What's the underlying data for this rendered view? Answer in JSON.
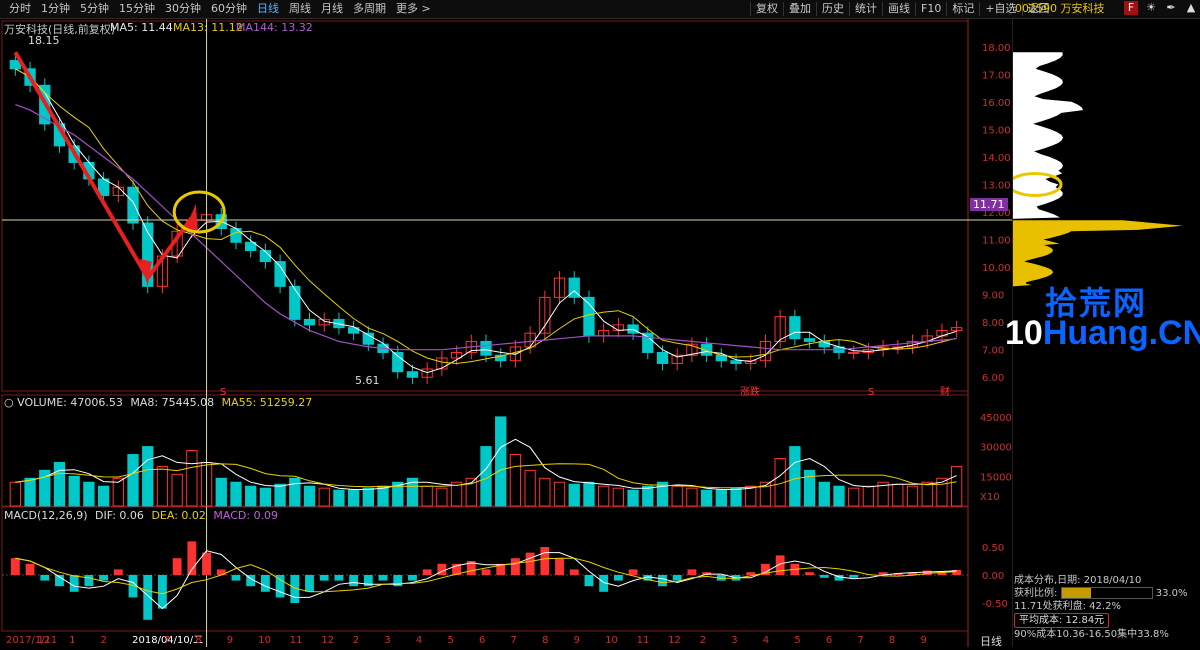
{
  "toolbar": {
    "tabs": [
      "分时",
      "1分钟",
      "5分钟",
      "15分钟",
      "30分钟",
      "60分钟",
      "日线",
      "周线",
      "月线",
      "多周期",
      "更多 >"
    ],
    "active_tab": "日线",
    "tools": [
      "复权",
      "叠加",
      "历史",
      "统计",
      "画线",
      "F10",
      "标记",
      "+自选",
      "返回"
    ],
    "stock": "002590 万安科技"
  },
  "price_panel": {
    "header": "万安科技(日线,前复权)",
    "ma5": "MA5: 11.44",
    "ma13": "MA13: 11.12",
    "ma144": "MA144: 13.32",
    "high_label": "18.15",
    "low_label": "5.61",
    "current": "11.71",
    "y_ticks": [
      "16.00",
      "17.00",
      "16.00",
      "15.00",
      "14.00",
      "13.00",
      "12.00",
      "11.00",
      "10.00",
      "9.00",
      "8.00",
      "7.00",
      "6.00"
    ],
    "markers": [
      "S",
      "涨跌",
      "S",
      "财"
    ]
  },
  "volume_panel": {
    "header_dot": "○",
    "volume": "VOLUME: 47006.53",
    "ma8": "MA8: 75445.08",
    "ma55": "MA55: 51259.27",
    "y_ticks": [
      "45000",
      "30000",
      "15000",
      "X10"
    ]
  },
  "macd_panel": {
    "header": "MACD(12,26,9)",
    "dif": "DIF: 0.06",
    "dea": "DEA: 0.02",
    "macd": "MACD: 0.09",
    "y_ticks": [
      "0.50",
      "0.00",
      "-0.50"
    ]
  },
  "x_axis": {
    "labels": [
      "2017/1/11",
      "12",
      "1",
      "2",
      "2018/04/10/二",
      "7",
      "8",
      "9",
      "10",
      "11",
      "12",
      "2",
      "3",
      "4",
      "5",
      "6",
      "7",
      "8",
      "9",
      "10",
      "11",
      "12",
      "2",
      "3",
      "4",
      "5",
      "6",
      "7",
      "8",
      "9"
    ],
    "period": "日线"
  },
  "cost_distribution": {
    "date": "成本分布,日期: 2018/04/10",
    "profit_ratio_label": "获利比例:",
    "profit_ratio": "33.0%",
    "profit_ratio_value": 0.33,
    "chips_line": "11.71处获利盘: 42.2%",
    "avg_cost": "平均成本: 12.84元",
    "concentration": "90%成本10.36-16.50集中33.8%"
  },
  "watermark": {
    "cn": "拾荒网",
    "prefix": "10",
    "rest": "Huang.CN"
  },
  "colors": {
    "up": "#ff3232",
    "down": "#00c8c8",
    "ma5": "#ffffff",
    "ma13": "#e8d000",
    "ma144": "#a050c8",
    "axis": "#c83232",
    "chip_profit": "#e8c000",
    "chip_loss": "#ffffff",
    "annotation": "#e82020"
  },
  "chart_data": {
    "type": "candlestick",
    "title": "万安科技(日线,前复权)",
    "ylim": [
      5.5,
      18.5
    ],
    "close": [
      17.2,
      16.6,
      15.2,
      14.4,
      13.8,
      13.2,
      12.6,
      12.9,
      11.6,
      9.3,
      10.4,
      11.3,
      11.7,
      11.9,
      11.4,
      10.9,
      10.6,
      10.2,
      9.3,
      8.1,
      7.9,
      8.1,
      7.8,
      7.6,
      7.2,
      6.9,
      6.2,
      6.0,
      6.3,
      6.7,
      6.9,
      7.3,
      6.8,
      6.6,
      7.1,
      7.6,
      8.9,
      9.6,
      8.9,
      7.5,
      7.7,
      7.9,
      7.6,
      6.9,
      6.5,
      6.8,
      7.2,
      6.8,
      6.6,
      6.5,
      6.6,
      7.3,
      8.2,
      7.4,
      7.3,
      7.1,
      6.9,
      6.9,
      7.0,
      7.1,
      7.1,
      7.3,
      7.5,
      7.7,
      7.8
    ],
    "ma144": [
      15.9,
      15.7,
      15.4,
      15.1,
      14.8,
      14.4,
      14.0,
      13.6,
      13.2,
      12.7,
      12.2,
      11.7,
      11.2,
      10.7,
      10.2,
      9.7,
      9.2,
      8.7,
      8.3,
      8.0,
      7.7,
      7.5,
      7.3,
      7.2,
      7.1,
      7.05,
      7.0,
      7.0,
      7.0,
      7.0,
      7.05,
      7.1,
      7.15,
      7.2,
      7.25,
      7.3,
      7.35,
      7.4,
      7.45,
      7.5,
      7.5,
      7.5,
      7.5,
      7.45,
      7.4,
      7.35,
      7.3,
      7.25,
      7.2,
      7.15,
      7.1,
      7.05,
      7.0,
      7.0,
      7.0,
      7.0,
      7.0,
      7.05,
      7.1,
      7.15,
      7.2,
      7.25,
      7.3,
      7.35,
      7.4
    ],
    "volume": [
      12,
      14,
      18,
      22,
      15,
      12,
      10,
      14,
      26,
      30,
      20,
      16,
      28,
      22,
      14,
      12,
      10,
      9,
      11,
      14,
      10,
      9,
      8,
      8,
      9,
      10,
      12,
      14,
      10,
      9,
      12,
      14,
      30,
      45,
      26,
      18,
      14,
      12,
      11,
      12,
      10,
      9,
      8,
      10,
      12,
      10,
      9,
      8,
      8,
      9,
      10,
      12,
      24,
      30,
      18,
      12,
      10,
      9,
      10,
      12,
      11,
      10,
      12,
      14,
      20
    ],
    "macd": [
      0.3,
      0.2,
      -0.1,
      -0.2,
      -0.3,
      -0.2,
      -0.1,
      0.1,
      -0.4,
      -0.8,
      -0.6,
      0.3,
      0.6,
      0.4,
      0.1,
      -0.1,
      -0.2,
      -0.3,
      -0.4,
      -0.5,
      -0.3,
      -0.1,
      -0.1,
      -0.2,
      -0.2,
      -0.1,
      -0.2,
      -0.1,
      0.1,
      0.2,
      0.2,
      0.25,
      0.1,
      0.2,
      0.3,
      0.4,
      0.5,
      0.3,
      0.1,
      -0.2,
      -0.3,
      -0.1,
      0.1,
      -0.1,
      -0.2,
      -0.1,
      0.1,
      0.05,
      -0.1,
      -0.1,
      0.05,
      0.2,
      0.35,
      0.2,
      0.05,
      -0.05,
      -0.1,
      -0.05,
      0.0,
      0.05,
      0.03,
      0.05,
      0.08,
      0.06,
      0.09
    ]
  }
}
